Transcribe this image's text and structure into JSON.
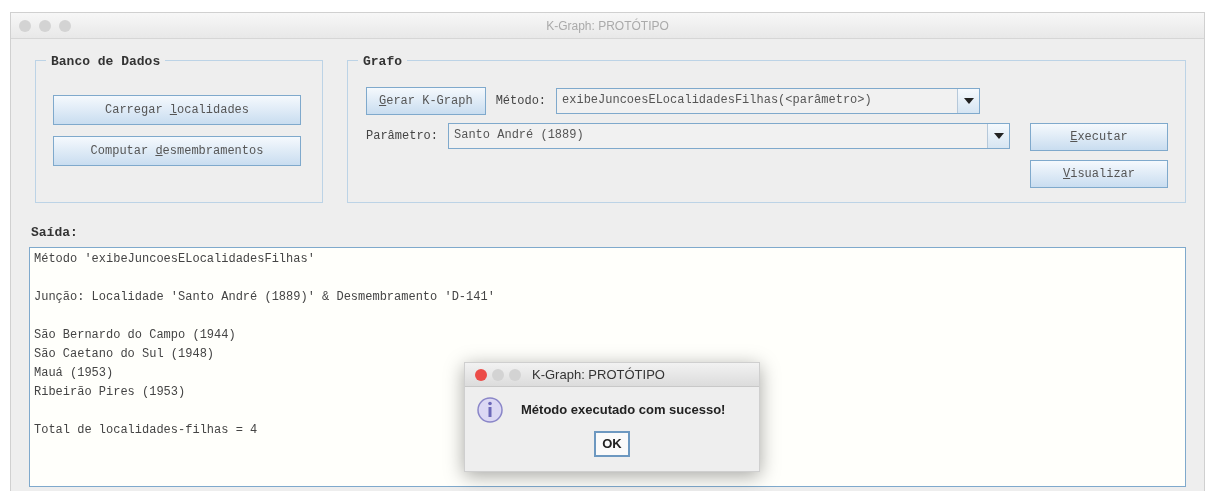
{
  "window": {
    "title": "K-Graph: PROTÓTIPO"
  },
  "banco_de_dados": {
    "title": "Banco de Dados",
    "buttons": [
      {
        "label_start": "Carregar ",
        "mnemonic": "l",
        "label_end": "ocalidades"
      },
      {
        "label_start": "Computar ",
        "mnemonic": "d",
        "label_end": "esmembramentos"
      }
    ]
  },
  "grafo": {
    "title": "Grafo",
    "gerar_button": {
      "mnemonic": "G",
      "label_end": "erar K-Graph"
    },
    "metodo": {
      "label": "Método:",
      "value": "exibeJuncoesELocalidadesFilhas(<parâmetro>)"
    },
    "parametro": {
      "label": "Parâmetro:",
      "value": "Santo André (1889)"
    },
    "buttons": [
      {
        "mnemonic": "E",
        "label_end": "xecutar"
      },
      {
        "mnemonic": "V",
        "label_end": "isualizar"
      }
    ]
  },
  "output": {
    "label": "Saída:",
    "paragraphs": [
      [
        "Método 'exibeJuncoesELocalidadesFilhas'"
      ],
      [
        "Junção: Localidade 'Santo André (1889)' & Desmembramento 'D-141'"
      ],
      [
        "São Bernardo do Campo (1944)",
        "São Caetano do Sul (1948)",
        "Mauá (1953)",
        "Ribeirão Pires (1953)"
      ],
      [
        "Total de localidades-filhas = 4"
      ]
    ]
  },
  "dialog": {
    "title": "K-Graph: PROTÓTIPO",
    "message": "Método executado com sucesso!",
    "button": "OK"
  }
}
